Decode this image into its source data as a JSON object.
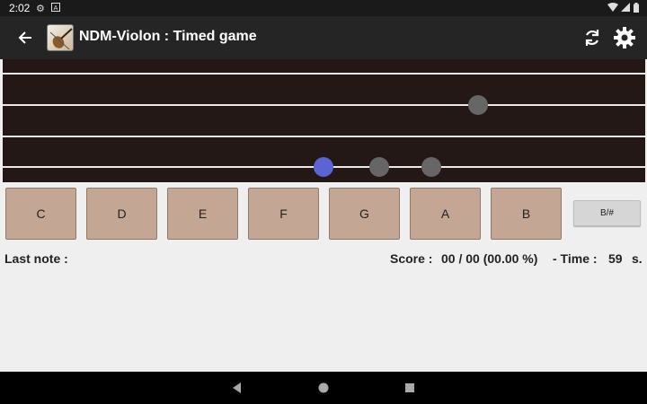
{
  "status_bar": {
    "time": "2:02",
    "icons": [
      "gear-icon",
      "a-icon",
      "wifi-icon",
      "signal-icon",
      "battery-icon"
    ]
  },
  "app_bar": {
    "title": "NDM-Violon : Timed game",
    "back_icon": "arrow-back-icon",
    "logo": "violin-icon",
    "actions": [
      "refresh-icon",
      "settings-icon"
    ]
  },
  "fretboard": {
    "strings": 4,
    "dots": [
      {
        "string": 3,
        "color": "#5c64d3",
        "role": "current-note"
      },
      {
        "string": 3,
        "color": "#666666",
        "role": "marker"
      },
      {
        "string": 3,
        "color": "#666666",
        "role": "marker"
      },
      {
        "string": 1,
        "color": "#666666",
        "role": "marker"
      }
    ]
  },
  "notes": [
    "C",
    "D",
    "E",
    "F",
    "G",
    "A",
    "B"
  ],
  "accidental_button": "B/#",
  "info": {
    "last_note_label": "Last note :",
    "score_label": "Score :",
    "score_value": "00 / 00 (00.00 %)",
    "time_label": "- Time :",
    "time_value": "59",
    "time_unit": "s."
  },
  "colors": {
    "status_bar": "#1a1a1a",
    "app_bar": "#252525",
    "fretboard": "#231815",
    "note_button": "#c3a794",
    "background": "#efefef"
  }
}
